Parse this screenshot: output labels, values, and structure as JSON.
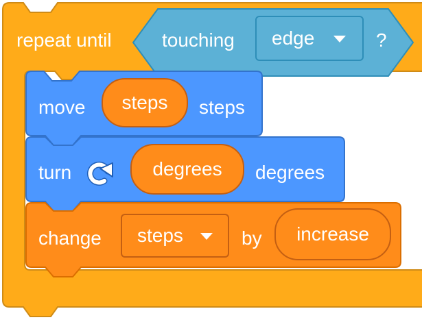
{
  "colors": {
    "control": "#ffab19",
    "control_border": "#cf8b17",
    "sensing": "#5cb1d6",
    "sensing_border": "#2e8eb8",
    "motion": "#4c97ff",
    "motion_border": "#3373cc",
    "variables": "#ff8c1a",
    "variables_border": "#db6e00"
  },
  "repeat_block": {
    "label": "repeat until",
    "condition": {
      "label": "touching",
      "menu_value": "edge",
      "suffix": "?"
    }
  },
  "move_block": {
    "label": "move",
    "reporter": "steps",
    "suffix": "steps"
  },
  "turn_block": {
    "label": "turn",
    "icon": "rotate-clockwise-icon",
    "reporter": "degrees",
    "suffix": "degrees"
  },
  "change_block": {
    "label": "change",
    "menu_value": "steps",
    "middle": "by",
    "reporter": "increase"
  }
}
